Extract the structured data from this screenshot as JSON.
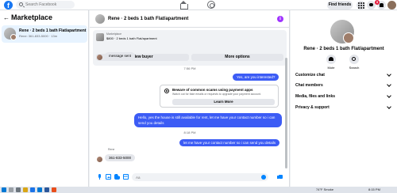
{
  "topbar": {
    "search_placeholder": "Search Facebook",
    "find_friends": "Find friends",
    "notification_count": "3"
  },
  "left": {
    "back_icon": "arrow-left-icon",
    "title": "Marketplace",
    "conversation": {
      "name": "Rene · 2 beds 1 bath Flat/apartment",
      "preview": "Rene: 361-833-5000 · 13m"
    }
  },
  "chat": {
    "header_title": "Rene · 2 beds 1 bath Flat/apartment",
    "listing": {
      "label": "Marketplace",
      "price_title": "$800 · 2 beds 1 bath Flat/apartment"
    },
    "view_buyer": "View buyer",
    "more_options": "More options",
    "messages": {
      "m1": "message sent",
      "time1": "7:56 PM",
      "m2": "Yes, are you interested?",
      "m3": "Hello, yes the house is still available for rent, let me have your contact number so i can send you details",
      "time2": "8:18 PM",
      "m4": "let me have your contact number so i can send you details",
      "sender": "Rene",
      "m5": "361-833-5000"
    },
    "scam_notice": {
      "title": "Beware of common scams using payment apps",
      "subtitle": "Watch out for fake emails or requests to upgrade your payment account.",
      "button": "Learn More"
    },
    "composer_placeholder": "Aa"
  },
  "right": {
    "title": "Rene · 2 beds 1 bath Flat/apartment",
    "mute": "Mute",
    "search": "Search",
    "items": [
      "Customize chat",
      "Chat members",
      "Media, files and links",
      "Privacy & support"
    ]
  },
  "taskbar": {
    "weather": "74°F Smoke",
    "time": "8:15 PM"
  }
}
